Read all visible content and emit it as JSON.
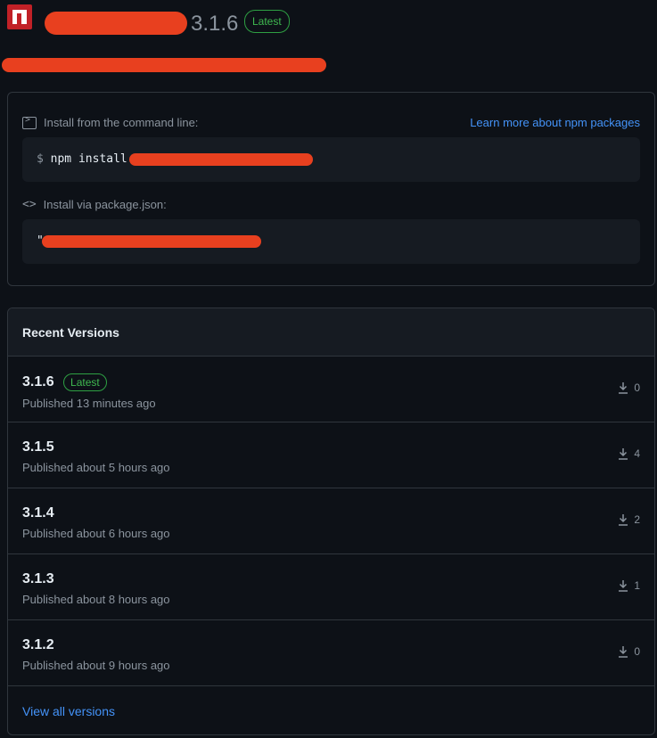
{
  "header": {
    "package_name": "",
    "version": "3.1.6",
    "latest_badge": "Latest",
    "description": ""
  },
  "install": {
    "cli_label": "Install from the command line:",
    "learn_more": "Learn more about npm packages",
    "cli_prompt": "$",
    "cli_command": "npm install @",
    "json_label": "Install via package.json:",
    "json_snippet": "\""
  },
  "versions": {
    "title": "Recent Versions",
    "latest_badge": "Latest",
    "items": [
      {
        "version": "3.1.6",
        "published": "Published 13 minutes ago",
        "downloads": "0"
      },
      {
        "version": "3.1.5",
        "published": "Published about 5 hours ago",
        "downloads": "4"
      },
      {
        "version": "3.1.4",
        "published": "Published about 6 hours ago",
        "downloads": "2"
      },
      {
        "version": "3.1.3",
        "published": "Published about 8 hours ago",
        "downloads": "1"
      },
      {
        "version": "3.1.2",
        "published": "Published about 9 hours ago",
        "downloads": "0"
      }
    ],
    "view_all": "View all versions"
  },
  "colors": {
    "background": "#0d1117",
    "border": "#30363d",
    "link": "#4493f8",
    "badge_green": "#3fb950",
    "npm_red": "#c12127",
    "redaction": "#e8401f"
  },
  "icons": {
    "logo": "npm-logo-icon",
    "terminal": "terminal-icon",
    "code": "code-icon",
    "download": "download-icon"
  }
}
